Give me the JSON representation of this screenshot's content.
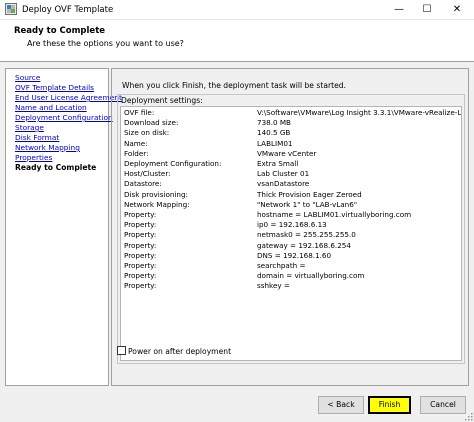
{
  "window": {
    "title": "Deploy OVF Template",
    "minimize_glyph": "—",
    "maximize_glyph": "☐",
    "close_glyph": "✕"
  },
  "header": {
    "title": "Ready to Complete",
    "subtitle": "Are these the options you want to use?"
  },
  "nav": {
    "items": [
      {
        "label": "Source",
        "current": false
      },
      {
        "label": "OVF Template Details",
        "current": false
      },
      {
        "label": "End User License Agreement",
        "current": false
      },
      {
        "label": "Name and Location",
        "current": false
      },
      {
        "label": "Deployment Configuration",
        "current": false
      },
      {
        "label": "Storage",
        "current": false
      },
      {
        "label": "Disk Format",
        "current": false
      },
      {
        "label": "Network Mapping",
        "current": false
      },
      {
        "label": "Properties",
        "current": false
      },
      {
        "label": "Ready to Complete",
        "current": true
      }
    ]
  },
  "main": {
    "info": "When you click Finish, the deployment task will be started.",
    "settings_label": "Deployment settings:",
    "settings": [
      {
        "key": "OVF file:",
        "value": "V:\\Software\\VMware\\Log Insight 3.3.1\\VMware-vRealize-Log-Insi..."
      },
      {
        "key": "Download size:",
        "value": "738.0 MB"
      },
      {
        "key": "Size on disk:",
        "value": "140.5 GB"
      },
      {
        "key": "Name:",
        "value": "LABLIM01"
      },
      {
        "key": "Folder:",
        "value": "VMware vCenter"
      },
      {
        "key": "Deployment Configuration:",
        "value": "Extra Small"
      },
      {
        "key": "Host/Cluster:",
        "value": "Lab Cluster 01"
      },
      {
        "key": "Datastore:",
        "value": "vsanDatastore"
      },
      {
        "key": "Disk provisioning:",
        "value": "Thick Provision Eager Zeroed"
      },
      {
        "key": "Network Mapping:",
        "value": "\"Network 1\" to \"LAB-vLan6\""
      },
      {
        "key": "Property:",
        "value": "hostname = LABLIM01.virtuallyboring.com"
      },
      {
        "key": "Property:",
        "value": "ip0 = 192.168.6.13"
      },
      {
        "key": "Property:",
        "value": "netmask0 = 255.255.255.0"
      },
      {
        "key": "Property:",
        "value": "gateway = 192.168.6.254"
      },
      {
        "key": "Property:",
        "value": "DNS = 192.168.1.60"
      },
      {
        "key": "Property:",
        "value": "searchpath ="
      },
      {
        "key": "Property:",
        "value": "domain = virtuallyboring.com"
      },
      {
        "key": "Property:",
        "value": "sshkey ="
      }
    ],
    "power_on_label": "Power on after deployment",
    "power_on_checked": false
  },
  "footer": {
    "back_label": "< Back",
    "finish_label": "Finish",
    "cancel_label": "Cancel"
  },
  "colors": {
    "link": "#0000cc",
    "finish_highlight": "#ffff00",
    "panel_background": "#f0f0f0"
  },
  "icons": {
    "app": "vsphere-app-icon",
    "resize": "resize-grip-icon"
  }
}
